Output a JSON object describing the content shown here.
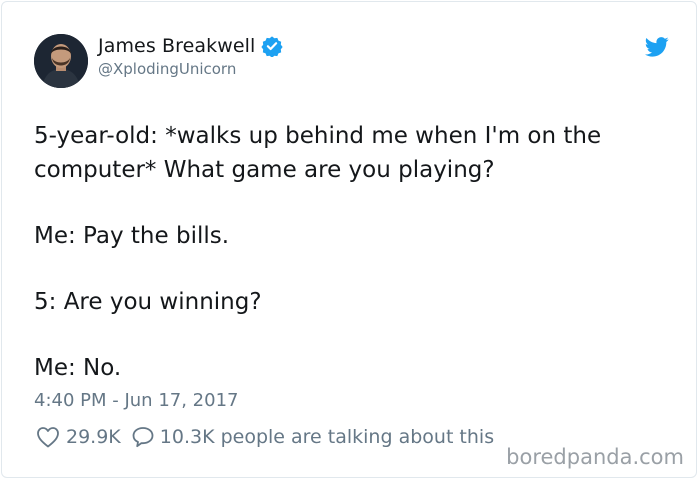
{
  "author": {
    "name": "James Breakwell",
    "handle": "@XplodingUnicorn",
    "verified": true
  },
  "tweet": {
    "line1": "5-year-old: *walks up behind me when I'm on the computer* What game are you playing?",
    "line2": "Me: Pay the bills.",
    "line3": "5: Are you winning?",
    "line4": "Me: No."
  },
  "meta": {
    "timestamp": "4:40 PM - Jun 17, 2017",
    "likes": "29.9K",
    "talking": "10.3K people are talking about this"
  },
  "watermark": "boredpanda.com",
  "colors": {
    "accent": "#1da1f2",
    "text": "#14171a",
    "muted": "#657786",
    "border": "#e1e8ed"
  },
  "icons": {
    "brand": "twitter-bird-icon",
    "verified": "verified-badge-icon",
    "like": "heart-icon",
    "reply": "speech-bubble-icon"
  }
}
